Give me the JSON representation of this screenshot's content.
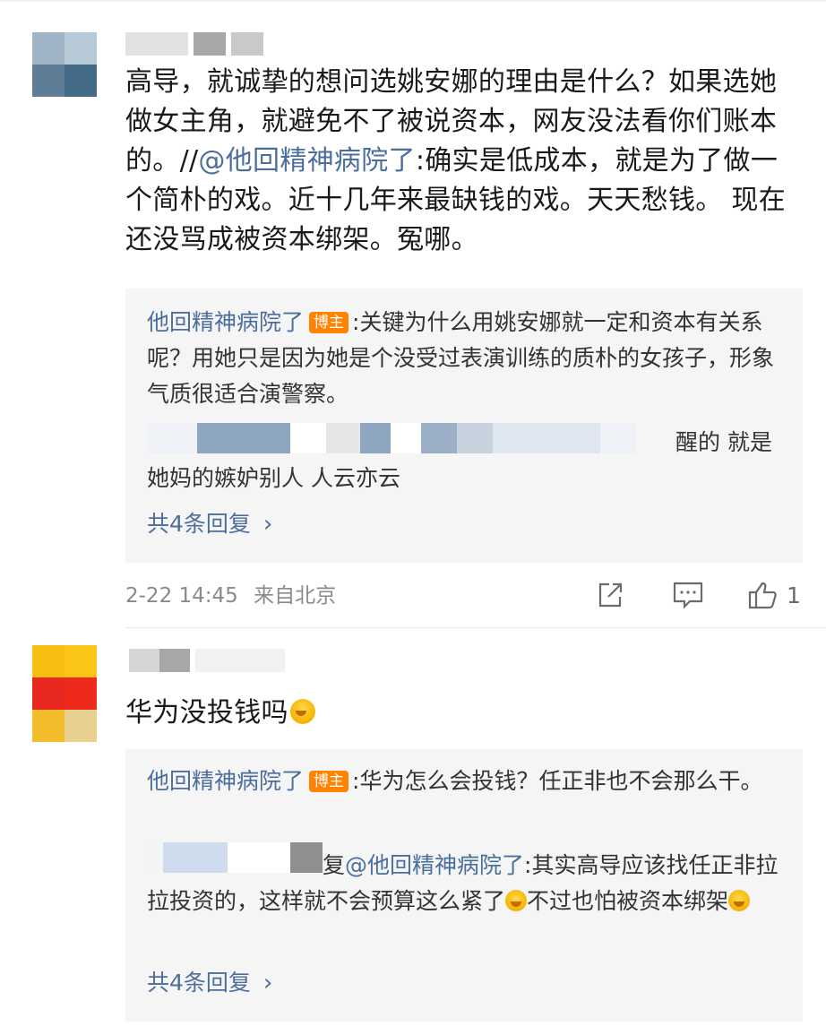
{
  "comment1": {
    "text_parts": {
      "before_mention": "高导，就诚挚的想问选姚安娜的理由是什么？如果选她做女主角，就避免不了被说资本，网友没法看你们账本的。//",
      "mention": "@他回精神病院了",
      "after_mention": ":确实是低成本，就是为了做一个简朴的戏。近十几年来最缺钱的戏。天天愁钱。 现在还没骂成被资本绑架。冤哪。"
    },
    "reply1": {
      "author": "他回精神病院了",
      "badge": "博主",
      "text": ":关键为什么用姚安娜就一定和资本有关系呢？用她只是因为她是个没受过表演训练的质朴的女孩子，形象气质很适合演警察。"
    },
    "reply2": {
      "visible_tail": "醒的 就是",
      "text": "她妈的嫉妒别人 人云亦云"
    },
    "more_replies": "共4条回复",
    "time": "2-22 14:45",
    "location": "来自北京",
    "like_count": "1"
  },
  "comment2": {
    "text": "华为没投钱吗",
    "reply1": {
      "author": "他回精神病院了",
      "badge": "博主",
      "text": ":华为怎么会投钱？任正非也不会那么干。"
    },
    "reply2": {
      "prefix_tail": "复",
      "mention": "@他回精神病院了",
      "text_a": ":其实高导应该找任正非拉拉投资的，这样就不会预算这么紧了",
      "text_b": "不过也怕被资本绑架"
    },
    "more_replies": "共4条回复"
  },
  "icons": {
    "share": "share-icon",
    "comment": "comment-icon",
    "like": "thumbs-up-icon",
    "emoji": "laugh-cry-emoji-icon",
    "chevron": "chevron-right-icon"
  },
  "colors": {
    "link": "#4b6f9c",
    "badge": "#ff8200",
    "reply_bg": "#f5f5f5",
    "meta": "#8a8a8a"
  }
}
